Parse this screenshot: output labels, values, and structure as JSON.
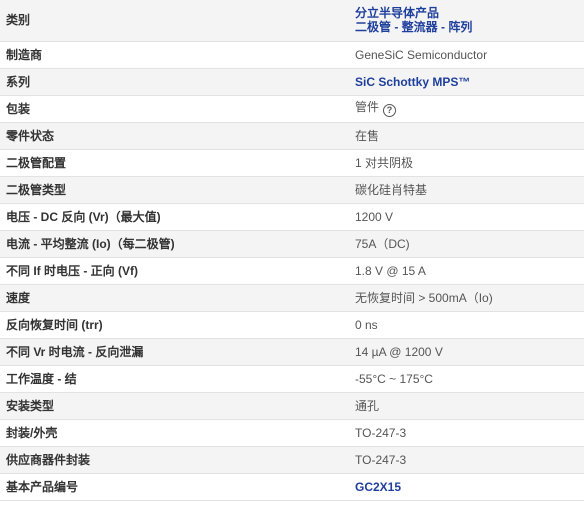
{
  "rows": [
    {
      "label": "类别",
      "values": [
        "分立半导体产品",
        "二极管 - 整流器 - 阵列"
      ],
      "link": true
    },
    {
      "label": "制造商",
      "value": "GeneSiC Semiconductor"
    },
    {
      "label": "系列",
      "value": "SiC Schottky MPS™",
      "link": true
    },
    {
      "label": "包装",
      "value": "管件",
      "icon": "help-icon",
      "icon_glyph": "?"
    },
    {
      "label": "零件状态",
      "value": "在售"
    },
    {
      "label": "二极管配置",
      "value": "1 对共阴极"
    },
    {
      "label": "二极管类型",
      "value": "碳化硅肖特基"
    },
    {
      "label": "电压 - DC 反向 (Vr)（最大值)",
      "value": "1200 V"
    },
    {
      "label": "电流 - 平均整流 (Io)（每二极管)",
      "value": "75A（DC)"
    },
    {
      "label": "不同 If 时电压 - 正向 (Vf)",
      "value": "1.8 V @ 15 A"
    },
    {
      "label": "速度",
      "value": "无恢复时间 > 500mA（Io)"
    },
    {
      "label": "反向恢复时间 (trr)",
      "value": "0 ns"
    },
    {
      "label": "不同 Vr 时电流 - 反向泄漏",
      "value": "14 µA @ 1200 V"
    },
    {
      "label": "工作温度 - 结",
      "value": "-55°C ~ 175°C"
    },
    {
      "label": "安装类型",
      "value": "通孔"
    },
    {
      "label": "封装/外壳",
      "value": "TO-247-3"
    },
    {
      "label": "供应商器件封装",
      "value": "TO-247-3"
    },
    {
      "label": "基本产品编号",
      "value": "GC2X15",
      "link": true
    }
  ],
  "colors": {
    "link": "#1f3f9c",
    "row_alt": "#f4f4f4",
    "border": "#e2e2e2"
  }
}
